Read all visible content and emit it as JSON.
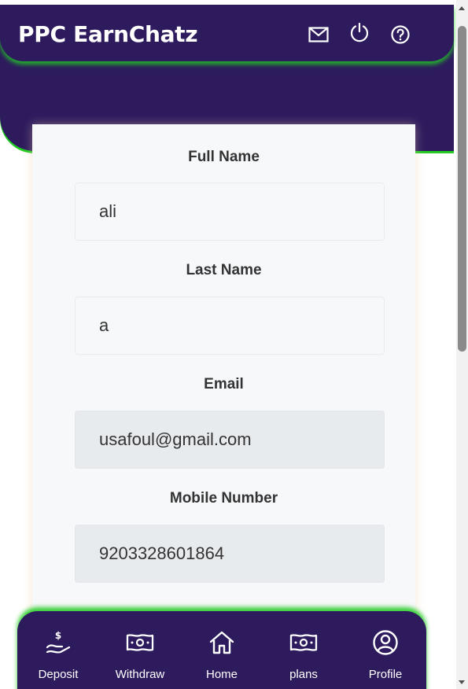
{
  "header": {
    "title": "PPC EarnChatz",
    "icons": [
      "envelope-icon",
      "power-icon",
      "help-icon"
    ]
  },
  "form": {
    "full_name": {
      "label": "Full Name",
      "value": "ali"
    },
    "last_name": {
      "label": "Last Name",
      "value": "a"
    },
    "email": {
      "label": "Email",
      "value": "usafoul@gmail.com"
    },
    "mobile": {
      "label": "Mobile Number",
      "value": "9203328601864"
    }
  },
  "nav": {
    "items": [
      {
        "label": "Deposit",
        "icon": "deposit-hand-dollar-icon"
      },
      {
        "label": "Withdraw",
        "icon": "banknote-icon"
      },
      {
        "label": "Home",
        "icon": "home-icon"
      },
      {
        "label": "plans",
        "icon": "banknote-icon"
      },
      {
        "label": "Profile",
        "icon": "user-circle-icon"
      }
    ]
  },
  "colors": {
    "brand_purple": "#2d1b5e",
    "accent_green": "#22cc22",
    "card_bg": "#f7f8fa",
    "readonly_bg": "#e8ebee"
  }
}
